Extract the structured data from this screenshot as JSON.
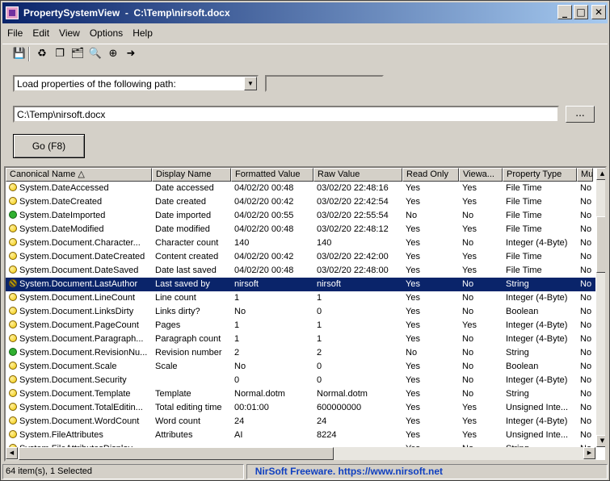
{
  "window": {
    "title": "PropertySystemView  -  C:\\Temp\\nirsoft.docx"
  },
  "menu": [
    "File",
    "Edit",
    "View",
    "Options",
    "Help"
  ],
  "toolbar": [
    {
      "icon": "save-icon",
      "glyph": "💾"
    },
    {
      "icon": "refresh-icon",
      "glyph": "♻"
    },
    {
      "icon": "copy-icon",
      "glyph": "❐"
    },
    {
      "icon": "properties-icon",
      "glyph": "🗂"
    },
    {
      "icon": "find-icon",
      "glyph": "🔍"
    },
    {
      "icon": "target-icon",
      "glyph": "⊕"
    },
    {
      "icon": "exit-icon",
      "glyph": "➜"
    }
  ],
  "mode_select": {
    "value": "Load properties of the following path:"
  },
  "path_input": {
    "value": "C:\\Temp\\nirsoft.docx"
  },
  "browse_label": "...",
  "go_label": "Go (F8)",
  "columns": [
    "Canonical Name",
    "Display Name",
    "Formatted Value",
    "Raw Value",
    "Read Only",
    "Viewa...",
    "Property Type",
    "Mul"
  ],
  "rows": [
    {
      "icon": "yellow",
      "c": [
        "System.DateAccessed",
        "Date accessed",
        "04/02/20 00:48",
        "03/02/20 22:48:16",
        "Yes",
        "Yes",
        "File Time",
        "No"
      ]
    },
    {
      "icon": "yellow",
      "c": [
        "System.DateCreated",
        "Date created",
        "04/02/20 00:42",
        "03/02/20 22:42:54",
        "Yes",
        "Yes",
        "File Time",
        "No"
      ]
    },
    {
      "icon": "green",
      "c": [
        "System.DateImported",
        "Date imported",
        "04/02/20 00:55",
        "03/02/20 22:55:54",
        "No",
        "No",
        "File Time",
        "No"
      ]
    },
    {
      "icon": "yellow",
      "c": [
        "System.DateModified",
        "Date modified",
        "04/02/20 00:48",
        "03/02/20 22:48:12",
        "Yes",
        "Yes",
        "File Time",
        "No"
      ]
    },
    {
      "icon": "yellow",
      "c": [
        "System.Document.Character...",
        "Character count",
        "140",
        "140",
        "Yes",
        "No",
        "Integer (4-Byte)",
        "No"
      ]
    },
    {
      "icon": "yellow",
      "c": [
        "System.Document.DateCreated",
        "Content created",
        "04/02/20 00:42",
        "03/02/20 22:42:00",
        "Yes",
        "Yes",
        "File Time",
        "No"
      ]
    },
    {
      "icon": "yellow",
      "c": [
        "System.Document.DateSaved",
        "Date last saved",
        "04/02/20 00:48",
        "03/02/20 22:48:00",
        "Yes",
        "Yes",
        "File Time",
        "No"
      ]
    },
    {
      "icon": "striped",
      "sel": true,
      "c": [
        "System.Document.LastAuthor",
        "Last saved by",
        "nirsoft",
        "nirsoft",
        "Yes",
        "No",
        "String",
        "No"
      ]
    },
    {
      "icon": "yellow",
      "c": [
        "System.Document.LineCount",
        "Line count",
        "1",
        "1",
        "Yes",
        "No",
        "Integer (4-Byte)",
        "No"
      ]
    },
    {
      "icon": "yellow",
      "c": [
        "System.Document.LinksDirty",
        "Links dirty?",
        "No",
        "0",
        "Yes",
        "No",
        "Boolean",
        "No"
      ]
    },
    {
      "icon": "yellow",
      "c": [
        "System.Document.PageCount",
        "Pages",
        "1",
        "1",
        "Yes",
        "Yes",
        "Integer (4-Byte)",
        "No"
      ]
    },
    {
      "icon": "yellow",
      "c": [
        "System.Document.Paragraph...",
        "Paragraph count",
        "1",
        "1",
        "Yes",
        "No",
        "Integer (4-Byte)",
        "No"
      ]
    },
    {
      "icon": "green",
      "c": [
        "System.Document.RevisionNu...",
        "Revision number",
        "2",
        "2",
        "No",
        "No",
        "String",
        "No"
      ]
    },
    {
      "icon": "yellow",
      "c": [
        "System.Document.Scale",
        "Scale",
        "No",
        "0",
        "Yes",
        "No",
        "Boolean",
        "No"
      ]
    },
    {
      "icon": "yellow",
      "c": [
        "System.Document.Security",
        "",
        "0",
        "0",
        "Yes",
        "No",
        "Integer (4-Byte)",
        "No"
      ]
    },
    {
      "icon": "yellow",
      "c": [
        "System.Document.Template",
        "Template",
        "Normal.dotm",
        "Normal.dotm",
        "Yes",
        "No",
        "String",
        "No"
      ]
    },
    {
      "icon": "yellow",
      "c": [
        "System.Document.TotalEditin...",
        "Total editing time",
        "00:01:00",
        "600000000",
        "Yes",
        "Yes",
        "Unsigned Inte...",
        "No"
      ]
    },
    {
      "icon": "yellow",
      "c": [
        "System.Document.WordCount",
        "Word count",
        "24",
        "24",
        "Yes",
        "Yes",
        "Integer (4-Byte)",
        "No"
      ]
    },
    {
      "icon": "yellow",
      "c": [
        "System.FileAttributes",
        "Attributes",
        "AI",
        "8224",
        "Yes",
        "Yes",
        "Unsigned Inte...",
        "No"
      ]
    },
    {
      "icon": "yellow",
      "c": [
        "System.FileAttributesDisplay",
        "",
        "",
        "",
        "Yes",
        "No",
        "String",
        "No"
      ]
    }
  ],
  "status": {
    "count": "64 item(s), 1 Selected",
    "link": "NirSoft Freeware. https://www.nirsoft.net"
  },
  "colors": {
    "selection": "#0a246a",
    "yellow_dot": "#f0c800",
    "green_dot": "#30b030",
    "link": "#1040c0"
  }
}
